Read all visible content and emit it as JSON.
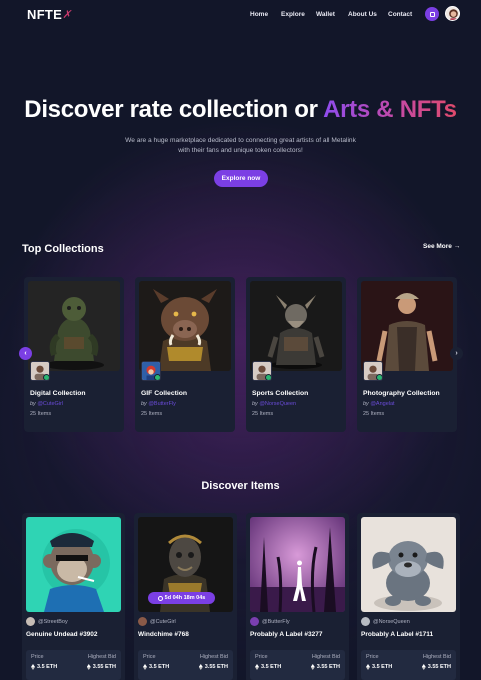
{
  "header": {
    "logo_text": "NFTE",
    "logo_mark": "✗",
    "nav": [
      "Home",
      "Explore",
      "Wallet",
      "About Us",
      "Contact"
    ],
    "action_icon": "wallet-icon",
    "avatar_icon": "user-avatar"
  },
  "hero": {
    "title_plain": "Discover rate collection or ",
    "title_highlight": "Arts & NFTs",
    "description": "We are a huge marketplace dedicated to connecting great artists of all Metalink with their fans and unique token collectors!",
    "cta_label": "Explore now"
  },
  "top_collections": {
    "title": "Top Collections",
    "see_more": "See More →",
    "prev_icon": "‹",
    "next_icon": "›",
    "items": [
      {
        "name": "Digital Collection",
        "by_prefix": "by",
        "author": "@CuteGirl",
        "count": "25 Items"
      },
      {
        "name": "GIF Collection",
        "by_prefix": "by",
        "author": "@ButterFly",
        "count": "25 Items"
      },
      {
        "name": "Sports Collection",
        "by_prefix": "by",
        "author": "@NorseQueen",
        "count": "25 Items"
      },
      {
        "name": "Photography Collection",
        "by_prefix": "by",
        "author": "@Angelat",
        "count": "25 Items"
      }
    ]
  },
  "discover": {
    "title": "Discover Items",
    "price_label": "Price",
    "bid_label": "Highest Bid",
    "items": [
      {
        "user": "@StreetBoy",
        "name": "Genuine Undead #3902",
        "price": "3.5 ETH",
        "bid": "3.55 ETH"
      },
      {
        "user": "@CuteGirl",
        "name": "Windchime #768",
        "price": "3.5 ETH",
        "bid": "3.55 ETH",
        "timer": "5d 04h 18m 04s"
      },
      {
        "user": "@ButterFly",
        "name": "Probably A Label #3277",
        "price": "3.5 ETH",
        "bid": "3.55 ETH"
      },
      {
        "user": "@NorseQueen",
        "name": "Probably A Label #1711",
        "price": "3.5 ETH",
        "bid": "3.55 ETH"
      }
    ]
  },
  "colors": {
    "background": "#121629",
    "card": "#1a2033",
    "accent": "#7b3fe4",
    "verified": "#2bb673"
  }
}
